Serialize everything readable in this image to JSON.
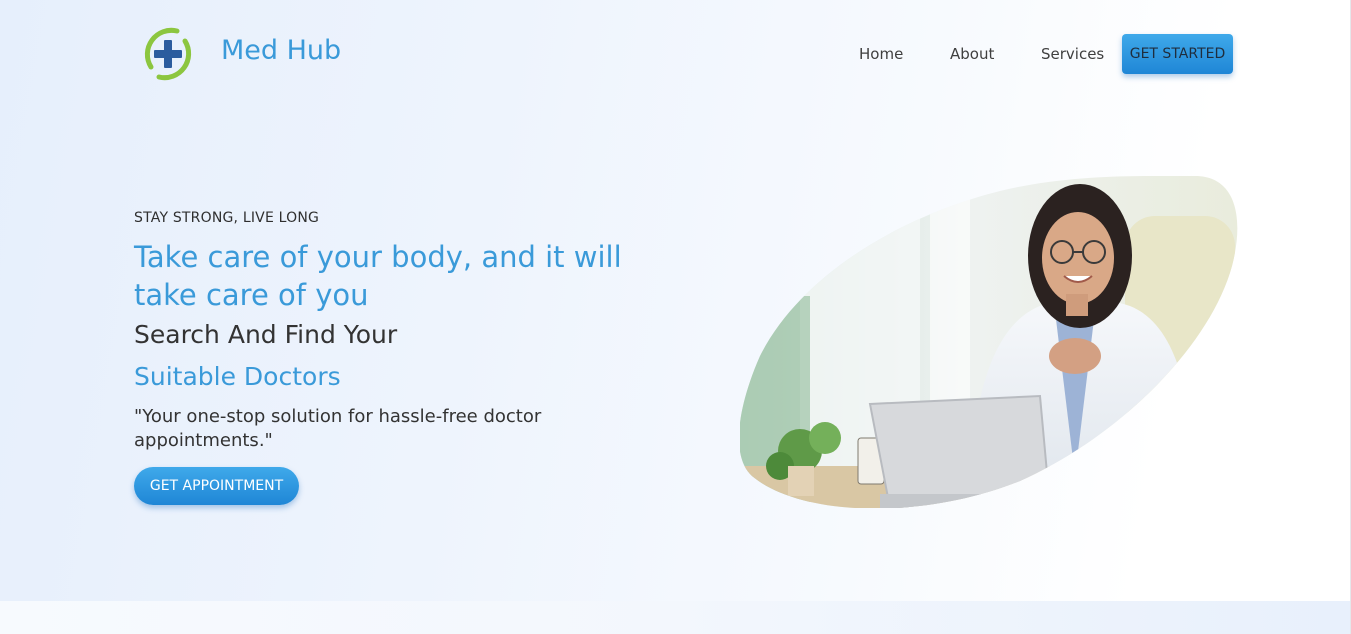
{
  "header": {
    "brand": "Med Hub",
    "logo_icon": "medical-cross-icon",
    "nav": [
      {
        "label": "Home"
      },
      {
        "label": "About"
      },
      {
        "label": "Services"
      }
    ],
    "cta_label": "GET STARTED"
  },
  "hero": {
    "tagline": "STAY STRONG, LIVE LONG",
    "headline": "Take care of your body, and it will take care of you",
    "subheading_1": "Search And Find Your",
    "subheading_2": "Suitable Doctors",
    "quote": "\"Your one-stop solution for hassle-free doctor appointments.\"",
    "cta_label": "GET APPOINTMENT",
    "image_icon": "doctor-photo"
  },
  "colors": {
    "accent": "#3a9ad9",
    "button": "#2a93e0",
    "logo_green": "#8cc63f",
    "logo_blue": "#2b5c9e"
  }
}
